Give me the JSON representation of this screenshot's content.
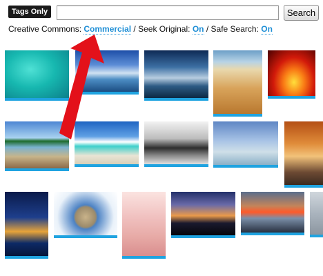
{
  "toolbar": {
    "tags_only_label": "Tags Only",
    "search_value": "",
    "search_button_label": "Search"
  },
  "options": {
    "creative_commons_label": "Creative Commons:",
    "creative_commons_value": "Commercial",
    "separator": "/",
    "seek_original_label": "Seek Original:",
    "seek_original_value": "On",
    "safe_search_label": "Safe Search:",
    "safe_search_value": "On"
  },
  "colors": {
    "link": "#1f8fd6",
    "thumb_underline": "#1fa3e0",
    "annotation_arrow": "#e3111a"
  },
  "thumbnails": [
    {
      "subject": "tropical-sea"
    },
    {
      "subject": "city-coast"
    },
    {
      "subject": "cloudy-sky-beach"
    },
    {
      "subject": "sand-beach-footprints"
    },
    {
      "subject": "red-sunset-palm"
    },
    {
      "subject": "pier-island"
    },
    {
      "subject": "beach-lounge-chairs"
    },
    {
      "subject": "black-white-portrait"
    },
    {
      "subject": "jumping-person-beach"
    },
    {
      "subject": "sunset-shore"
    },
    {
      "subject": "night-sea-glow"
    },
    {
      "subject": "fisheye-planet"
    },
    {
      "subject": "woman-beach"
    },
    {
      "subject": "sunset-silhouettes"
    },
    {
      "subject": "pier-sunset"
    },
    {
      "subject": "partial-photo"
    }
  ]
}
